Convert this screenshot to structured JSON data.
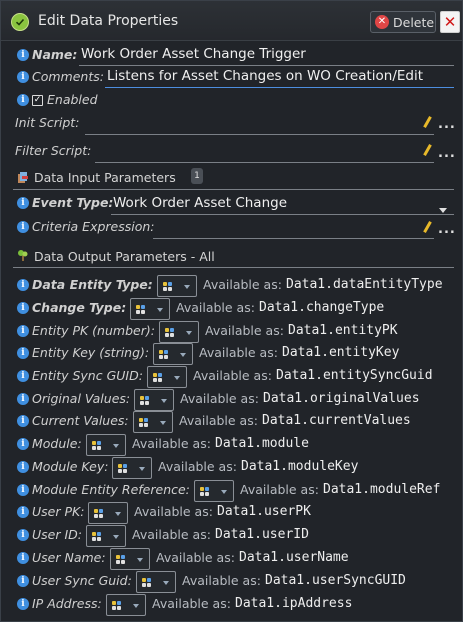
{
  "dialog": {
    "title": "Edit Data Properties",
    "delete_label": "Delete",
    "close_symbol": "✕"
  },
  "fields": {
    "name_label": "Name:",
    "name_value": "Work Order Asset Change Trigger",
    "comments_label": "Comments:",
    "comments_value": "Listens for Asset Changes on WO Creation/Edit",
    "enabled_label": "Enabled",
    "enabled_checked": true,
    "init_script_label": "Init Script:",
    "filter_script_label": "Filter Script:",
    "edit_button_label": "..."
  },
  "input_section": {
    "title": "Data Input Parameters",
    "badge": "1",
    "event_type_label": "Event Type:",
    "event_type_value": "Work Order Asset Change",
    "criteria_label": "Criteria Expression:"
  },
  "output_section": {
    "title": "Data Output Parameters - All",
    "available_prefix": "Available as:",
    "params": [
      {
        "label": "Data Entity Type:",
        "var": "Data1.dataEntityType",
        "bold": true
      },
      {
        "label": "Change Type:",
        "var": "Data1.changeType",
        "bold": true
      },
      {
        "label": "Entity PK (number):",
        "var": "Data1.entityPK",
        "bold": false
      },
      {
        "label": "Entity Key (string):",
        "var": "Data1.entityKey",
        "bold": false
      },
      {
        "label": "Entity Sync GUID:",
        "var": "Data1.entitySyncGuid",
        "bold": false
      },
      {
        "label": "Original Values:",
        "var": "Data1.originalValues",
        "bold": false
      },
      {
        "label": "Current Values:",
        "var": "Data1.currentValues",
        "bold": false
      },
      {
        "label": "Module:",
        "var": "Data1.module",
        "bold": false
      },
      {
        "label": "Module Key:",
        "var": "Data1.moduleKey",
        "bold": false
      },
      {
        "label": "Module Entity Reference:",
        "var": "Data1.moduleRef",
        "bold": false
      },
      {
        "label": "User PK:",
        "var": "Data1.userPK",
        "bold": false
      },
      {
        "label": "User ID:",
        "var": "Data1.userID",
        "bold": false
      },
      {
        "label": "User Name:",
        "var": "Data1.userName",
        "bold": false
      },
      {
        "label": "User Sync Guid:",
        "var": "Data1.userSyncGUID",
        "bold": false
      },
      {
        "label": "IP Address:",
        "var": "Data1.ipAddress",
        "bold": false
      }
    ]
  },
  "icons": {
    "title": "checkmark-circle-icon",
    "delete": "delete-x-icon",
    "info": "info-icon",
    "pencil": "pencil-icon",
    "input_section": "input-parameters-icon",
    "output_section": "output-parameters-icon",
    "mapping": "mapping-icon"
  },
  "colors": {
    "background": "#212429",
    "accent_blue": "#3f8fe0",
    "delete_red": "#e04646",
    "title_green": "#8ac43f"
  }
}
